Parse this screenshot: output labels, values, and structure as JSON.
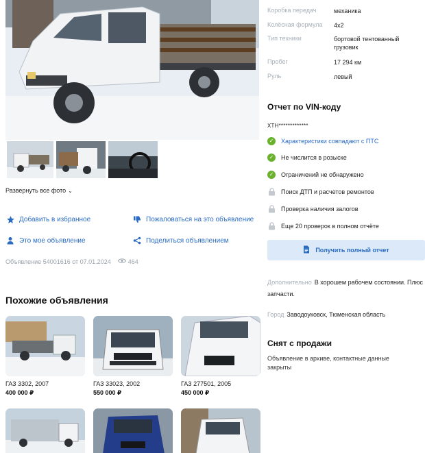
{
  "gallery": {
    "expand_label": "Развернуть все фото"
  },
  "actions": {
    "favorite": "Добавить в избранное",
    "complain": "Пожаловаться на это объявление",
    "mine": "Это мое объявление",
    "share": "Поделиться объявлением"
  },
  "listing": {
    "id_text": "Объявление 54001616 от 07.01.2024",
    "views": "464"
  },
  "similar": {
    "title": "Похожие объявления",
    "items": [
      {
        "name": "ГАЗ 3302, 2007",
        "price": "400 000 ₽"
      },
      {
        "name": "ГАЗ 33023, 2002",
        "price": "550 000 ₽"
      },
      {
        "name": "ГАЗ 277501, 2005",
        "price": "450 000 ₽"
      }
    ]
  },
  "specs": [
    {
      "key": "Коробка передач",
      "value": "механика"
    },
    {
      "key": "Колёсная формула",
      "value": "4x2"
    },
    {
      "key": "Тип техники",
      "value": "бортовой тентованный грузовик"
    },
    {
      "key": "Пробег",
      "value": "17 294 км"
    },
    {
      "key": "Руль",
      "value": "левый"
    }
  ],
  "vin_report": {
    "title": "Отчет по VIN-коду",
    "vin": "XTH*************",
    "checks": [
      {
        "label": "Характеристики совпадают с ПТС",
        "status": "ok",
        "link": true
      },
      {
        "label": "Не числится в розыске",
        "status": "ok",
        "link": false
      },
      {
        "label": "Ограничений не обнаружено",
        "status": "ok",
        "link": false
      },
      {
        "label": "Поиск ДТП и расчетов ремонтов",
        "status": "locked",
        "link": false
      },
      {
        "label": "Проверка наличия залогов",
        "status": "locked",
        "link": false
      },
      {
        "label": "Еще 20 проверок в полном отчёте",
        "status": "locked",
        "link": false
      }
    ],
    "button_label": "Получить полный отчет"
  },
  "details": {
    "extra_key": "Дополнительно",
    "extra_value": "В хорошем рабочем состоянии. Плюс запчасти.",
    "city_key": "Город",
    "city_value": "Заводоуковск, Тюменская область"
  },
  "status": {
    "title": "Снят с продажи",
    "text": "Объявление в архиве, контактные данные закрыты"
  },
  "colors": {
    "accent": "#2a6bc4",
    "ok": "#6ab22e",
    "button_bg": "#dbe9f8"
  }
}
